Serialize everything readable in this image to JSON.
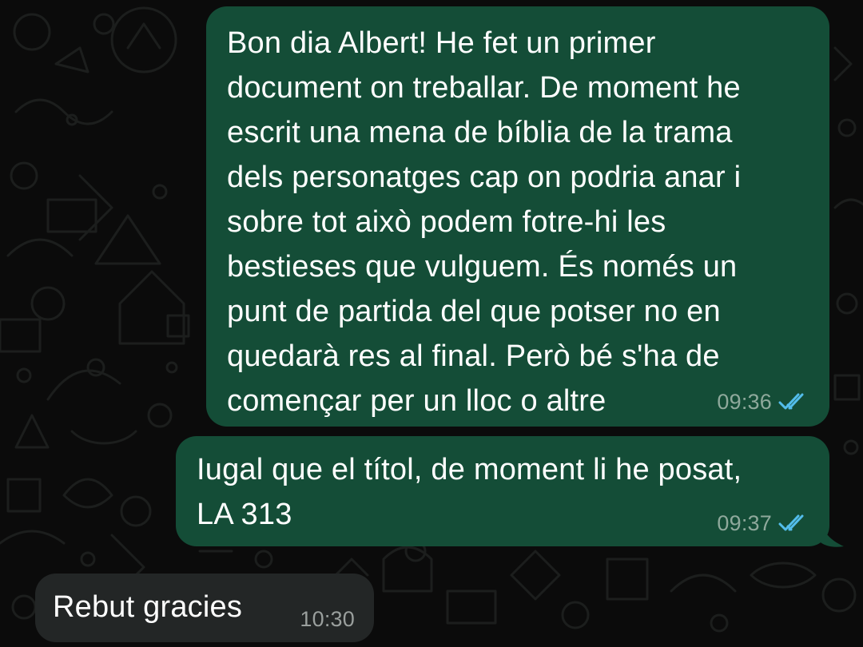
{
  "messages": [
    {
      "direction": "outgoing",
      "text": "Bon dia Albert! He fet un primer\ndocument on treballar. De moment he\nescrit una mena de bíblia de la trama\ndels personatges cap on podria anar i\nsobre tot això podem fotre-hi les\nbestieses que vulguem. És només un\npunt de partida del que potser no en\nquedarà res al final. Però bé s'ha de\ncomençar per un lloc o altre",
      "time": "09:36",
      "status_icon": "double-check-read-icon"
    },
    {
      "direction": "outgoing",
      "text": "Iugal que el títol, de moment li he posat,\nLA 313",
      "time": "09:37",
      "status_icon": "double-check-read-icon"
    },
    {
      "direction": "incoming",
      "text": "Rebut gracies",
      "time": "10:30"
    }
  ],
  "colors": {
    "background": "#0b0b0b",
    "outgoing_bubble": "#144d37",
    "incoming_bubble": "#232626",
    "read_ticks": "#53bdeb",
    "doodle": "#1a1c1b"
  }
}
